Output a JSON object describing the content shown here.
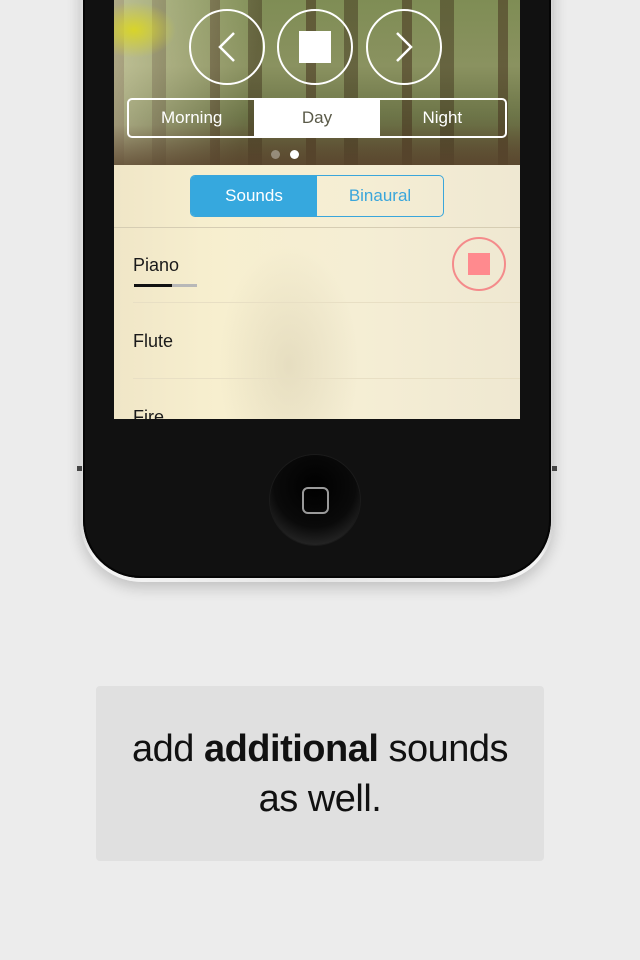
{
  "player": {
    "prev_icon": "chevron-left-icon",
    "stop_icon": "stop-icon",
    "next_icon": "chevron-right-icon"
  },
  "time_of_day": {
    "options": [
      "Morning",
      "Day",
      "Night"
    ],
    "selected": "Day"
  },
  "page_dots": {
    "count": 2,
    "active_index": 1
  },
  "sound_type": {
    "options": [
      "Sounds",
      "Binaural"
    ],
    "selected": "Sounds"
  },
  "sounds": [
    {
      "name": "Piano",
      "playing": true,
      "volume": 0.6
    },
    {
      "name": "Flute",
      "playing": false
    },
    {
      "name": "Fire",
      "playing": false
    }
  ],
  "colors": {
    "accent_blue": "#36a8de",
    "stop_red": "#ff8a8e"
  },
  "caption": {
    "pre": "add ",
    "bold": "additional",
    "post": " sounds",
    "line2": "as well."
  }
}
